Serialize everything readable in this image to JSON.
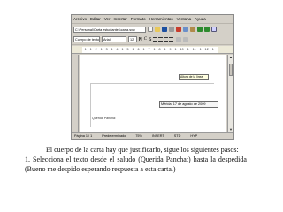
{
  "editor": {
    "menu": [
      "Archivo",
      "Editar",
      "Ver",
      "Insertar",
      "Formato",
      "Herramientas",
      "Ventana",
      "Ayuda"
    ],
    "url_value": "C:\\Personal\\Carta estudiantes\\carta.sxw",
    "style_value": "Cuerpo de texto",
    "font_value": "Arial",
    "size_value": "12",
    "bold_label": "N",
    "italic_label": "C",
    "underline_label": "S",
    "ruler_text": "· 1 · 1 · 2 · 1 · 3 · 1 · 4 · 1 · 5 · 1 · 6 · 1 · 7 · 1 · 8 · 1 · 9 · 1 · 10 · 1 · 11 · 1 · 12 · 1 · 13 ·",
    "tooltip_text": "Altura de la línea",
    "date_text": "Mérida, 17 de agosto de 2009",
    "greeting_text": "Querida Pancha:",
    "status": {
      "page": "Página 1 / 1",
      "style": "Predeterminado",
      "zoom": "75%",
      "mode": "INSERT",
      "std": "STD",
      "hyp": "HYP"
    },
    "accent_colors": [
      "#1c4fa0",
      "#c83c2c",
      "#2e8b2e"
    ]
  },
  "caption": {
    "line1": "El cuerpo de la carta hay que justificarlo, sigue los siguientes pasos:",
    "line2": "1. Selecciona el texto desde el saludo (Querida Pancha:)   hasta   la despedida",
    "line3": "(Bueno me despido esperando respuesta a esta carta.)"
  }
}
